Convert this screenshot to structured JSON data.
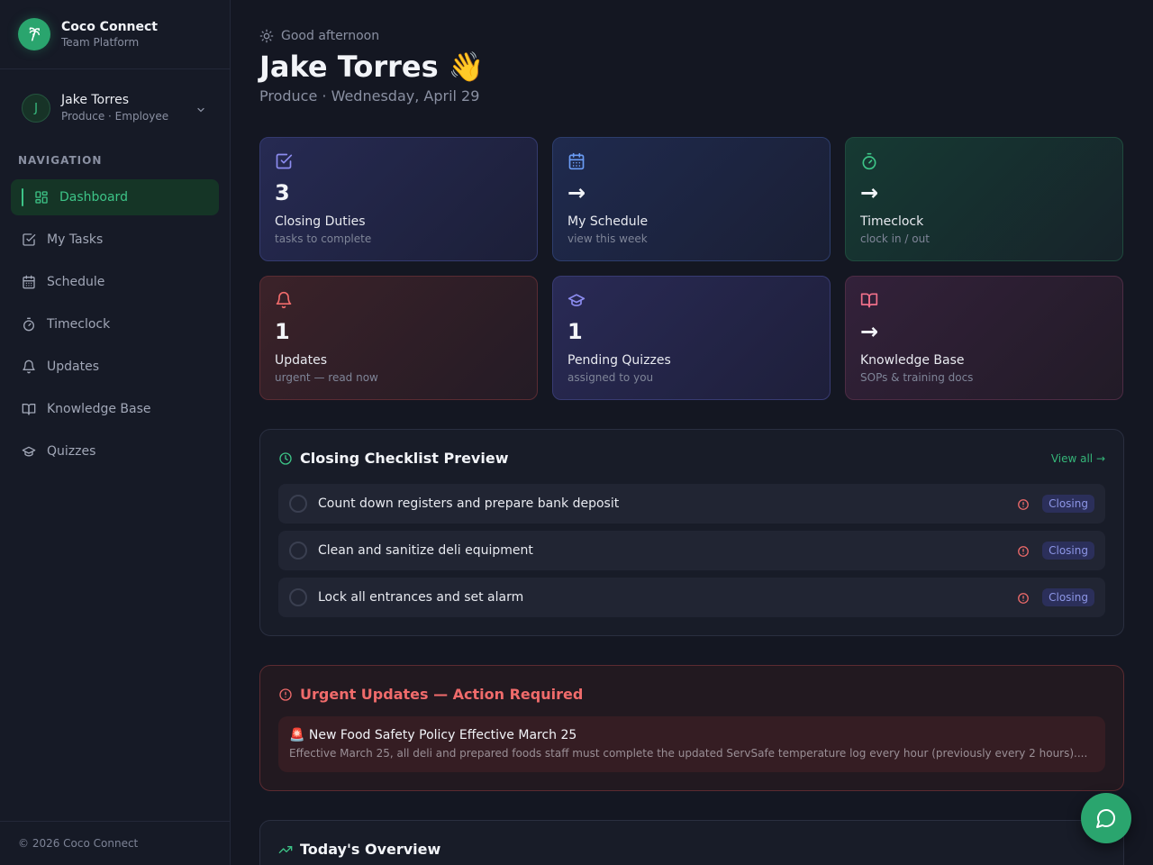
{
  "brand": {
    "title": "Coco Connect",
    "subtitle": "Team Platform"
  },
  "user": {
    "initial": "J",
    "name": "Jake Torres",
    "role": "Produce · Employee"
  },
  "nav": {
    "heading": "NAVIGATION",
    "items": [
      {
        "label": "Dashboard",
        "icon": "dashboard-icon",
        "active": true
      },
      {
        "label": "My Tasks",
        "icon": "checkbox-icon"
      },
      {
        "label": "Schedule",
        "icon": "calendar-icon"
      },
      {
        "label": "Timeclock",
        "icon": "stopwatch-icon"
      },
      {
        "label": "Updates",
        "icon": "bell-icon"
      },
      {
        "label": "Knowledge Base",
        "icon": "book-icon"
      },
      {
        "label": "Quizzes",
        "icon": "graduation-cap-icon"
      }
    ]
  },
  "footer": {
    "text": "© 2026 Coco Connect"
  },
  "header": {
    "greeting": "Good afternoon",
    "title": "Jake Torres 👋",
    "subtitle": "Produce · Wednesday, April 29"
  },
  "cards": [
    {
      "value": "3",
      "label": "Closing Duties",
      "sub": "tasks to complete",
      "icon": "checkbox-icon",
      "accent": "#8c8cf0"
    },
    {
      "value": "→",
      "label": "My Schedule",
      "sub": "view this week",
      "icon": "calendar-icon",
      "accent": "#6a9cf5"
    },
    {
      "value": "→",
      "label": "Timeclock",
      "sub": "clock in / out",
      "icon": "stopwatch-icon",
      "accent": "#3dc487"
    },
    {
      "value": "1",
      "label": "Updates",
      "sub": "urgent — read now",
      "icon": "bell-icon",
      "accent": "#f06b6b"
    },
    {
      "value": "1",
      "label": "Pending Quizzes",
      "sub": "assigned to you",
      "icon": "graduation-cap-icon",
      "accent": "#8c8cf0"
    },
    {
      "value": "→",
      "label": "Knowledge Base",
      "sub": "SOPs & training docs",
      "icon": "book-icon",
      "accent": "#f0708a"
    }
  ],
  "checklist": {
    "title": "Closing Checklist Preview",
    "view_all": "View all →",
    "items": [
      {
        "text": "Count down registers and prepare bank deposit",
        "tag": "Closing"
      },
      {
        "text": "Clean and sanitize deli equipment",
        "tag": "Closing"
      },
      {
        "text": "Lock all entrances and set alarm",
        "tag": "Closing"
      }
    ]
  },
  "urgent": {
    "title": "Urgent Updates — Action Required",
    "item_title": "🚨 New Food Safety Policy Effective March 25",
    "item_body": "Effective March 25, all deli and prepared foods staff must complete the updated ServSafe temperature log every hour (previously every 2 hours)...."
  },
  "overview": {
    "title": "Today's Overview"
  },
  "colors": {
    "accent": "#2aa56e",
    "danger": "#f06b6b",
    "background": "#141722"
  }
}
